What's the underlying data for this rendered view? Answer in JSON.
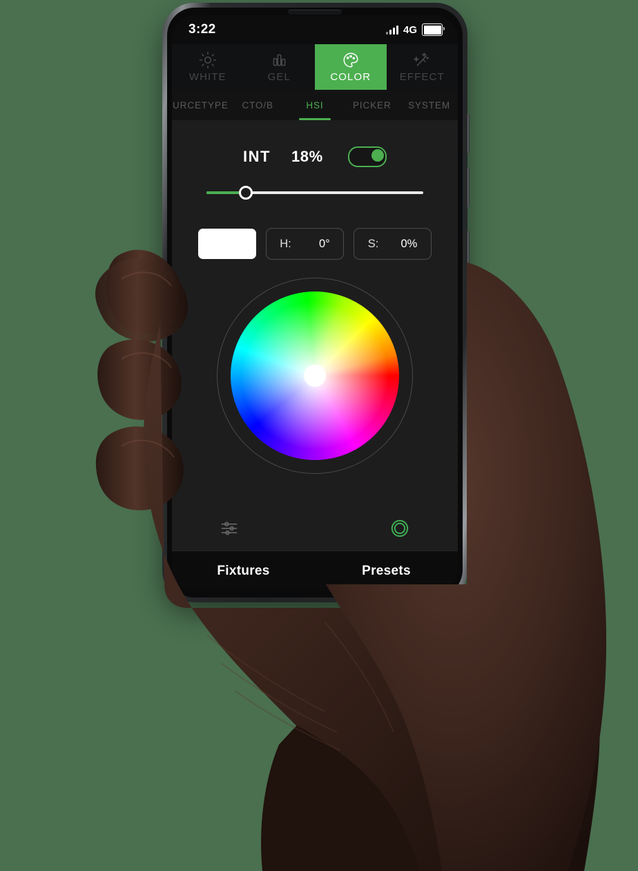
{
  "background_color": "#4a7050",
  "accent_color": "#4caf50",
  "status_bar": {
    "time": "3:22",
    "network": "4G",
    "signal_icon": "signal-bars-icon",
    "battery_icon": "battery-icon"
  },
  "main_tabs": [
    {
      "label": "WHITE",
      "icon": "sun-icon",
      "active": false
    },
    {
      "label": "GEL",
      "icon": "bar-chart-icon",
      "active": false
    },
    {
      "label": "COLOR",
      "icon": "palette-icon",
      "active": true
    },
    {
      "label": "EFFECT",
      "icon": "magic-wand-icon",
      "active": false
    }
  ],
  "sub_tabs": [
    {
      "label": "URCETYPE",
      "active": false
    },
    {
      "label": "CTO/B",
      "active": false
    },
    {
      "label": "HSI",
      "active": true
    },
    {
      "label": "PICKER",
      "active": false
    },
    {
      "label": "SYSTEM",
      "active": false
    }
  ],
  "intensity": {
    "label": "INT",
    "value": "18%",
    "percent": 18,
    "toggle_on": true
  },
  "color_fields": {
    "swatch_color": "#ffffff",
    "hue": {
      "key": "H:",
      "value": "0°"
    },
    "saturation": {
      "key": "S:",
      "value": "0%"
    }
  },
  "color_wheel": {
    "handle_hue": 0,
    "handle_saturation": 0,
    "handle_color": "#ffffff"
  },
  "foot_icons": [
    {
      "name": "sliders-icon",
      "active": false
    },
    {
      "name": "color-ring-icon",
      "active": true
    }
  ],
  "bottom_nav": [
    {
      "label": "Fixtures"
    },
    {
      "label": "Presets"
    }
  ]
}
